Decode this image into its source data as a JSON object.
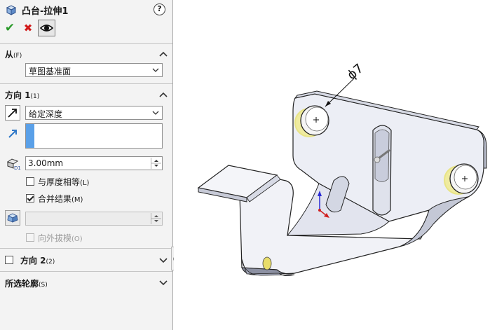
{
  "panel": {
    "title": "凸台-拉伸1",
    "help_label": "?",
    "ok_symbol": "✔",
    "cancel_symbol": "✖",
    "from": {
      "header": "从",
      "header_suffix": "(F)",
      "start_condition": "草图基准面"
    },
    "direction1": {
      "header": "方向 1",
      "header_suffix": "(1)",
      "end_condition": "给定深度",
      "depth": "3.00mm",
      "equal_thickness": {
        "label": "与厚度相等",
        "suffix": "(L)",
        "checked": false
      },
      "merge_result": {
        "label": "合并结果",
        "suffix": "(M)",
        "checked": true
      },
      "draft_outward": {
        "label": "向外拔模",
        "suffix": "(O)",
        "checked": false,
        "enabled": false
      }
    },
    "direction2": {
      "header": "方向 2",
      "header_suffix": "(2)",
      "checked": false
    },
    "contours": {
      "header": "所选轮廓",
      "header_suffix": "(S)"
    }
  },
  "viewport": {
    "dimension_label": "ϕ7"
  },
  "colors": {
    "accent_blue": "#5aa0e8",
    "ok_green": "#2b9a2b",
    "cancel_red": "#d21a1a",
    "hole_highlight": "#f2ea5a"
  }
}
